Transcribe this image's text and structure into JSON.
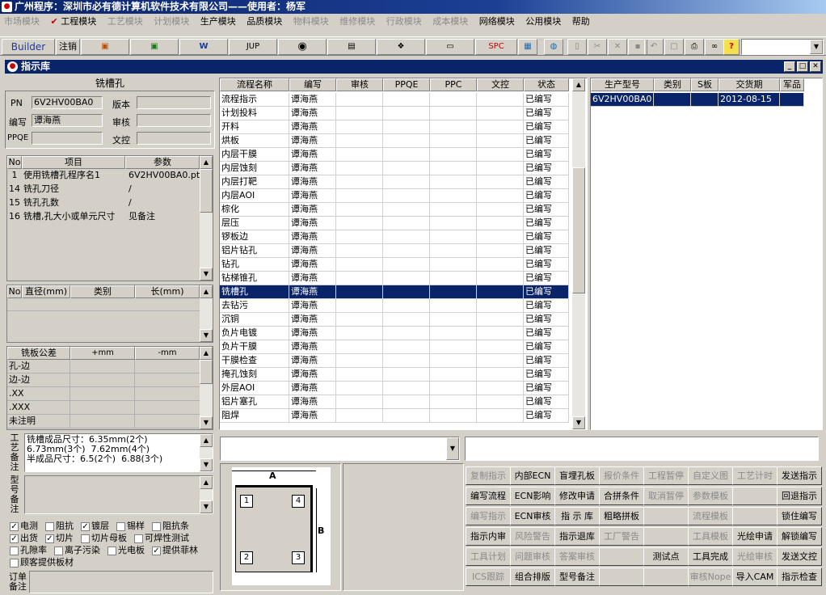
{
  "app_title": "广州程序：深圳市必有德计算机软件技术有限公司——使用者：杨军",
  "menu": [
    "市场模块",
    "工程模块",
    "工艺模块",
    "计划模块",
    "生产模块",
    "品质模块",
    "物料模块",
    "维修模块",
    "行政模块",
    "成本模块",
    "网络模块",
    "公用模块",
    "帮助"
  ],
  "toolbar": {
    "builder": "Builder",
    "logout": "注销",
    "jup": "JUP",
    "spc": "SPC"
  },
  "window_title": "指示库",
  "left": {
    "header": "铣槽孔",
    "pn_label": "PN",
    "pn_value": "6V2HV00BA0",
    "version_label": "版本",
    "author_label": "编写",
    "author_value": "谭海燕",
    "review_label": "审核",
    "ppqe_label": "PPQE",
    "doc_label": "文控",
    "params_cols": [
      "No",
      "项目",
      "参数"
    ],
    "params": [
      {
        "no": "1",
        "item": "使用铣槽孔程序名1",
        "val": "6V2HV00BA0.pth"
      },
      {
        "no": "14",
        "item": "铣孔刀径",
        "val": "/"
      },
      {
        "no": "15",
        "item": "铣孔孔数",
        "val": "/"
      },
      {
        "no": "16",
        "item": "铣槽,孔大小或单元尺寸",
        "val": "见备注"
      }
    ],
    "tool_cols": [
      "No",
      "直径(mm)",
      "类别",
      "长(mm)"
    ],
    "tol_cols": [
      "铣板公差",
      "+mm",
      "-mm"
    ],
    "tol_rows": [
      "孔-边",
      "边-边",
      ".XX",
      ".XXX",
      "未注明"
    ],
    "process_note_label": "工艺备注",
    "process_note": "铣槽成品尺寸：6.35mm(2个)  6.73mm(3个)  7.62mm(4个)\n半成品尺寸：6.5(2个)  6.88(3个)",
    "model_note_label": "型号备注",
    "checks": [
      [
        {
          "t": "电测",
          "c": true
        },
        {
          "t": "阻抗",
          "c": false
        },
        {
          "t": "镀层",
          "c": true
        },
        {
          "t": "锡样",
          "c": false
        },
        {
          "t": "阻抗条",
          "c": false
        }
      ],
      [
        {
          "t": "出货",
          "c": true
        },
        {
          "t": "切片",
          "c": true
        },
        {
          "t": "切片母板",
          "c": false
        },
        {
          "t": "可焊性测试",
          "c": false
        }
      ],
      [
        {
          "t": "孔隙率",
          "c": false
        },
        {
          "t": "离子污染",
          "c": false
        },
        {
          "t": "光电板",
          "c": false
        },
        {
          "t": "提供菲林",
          "c": true
        }
      ],
      [
        {
          "t": "顾客提供板材",
          "c": false
        }
      ]
    ],
    "order_note_label": "订单备注"
  },
  "process_cols": [
    "流程名称",
    "编写",
    "审核",
    "PPQE",
    "PPC",
    "文控",
    "状态"
  ],
  "process_rows": [
    {
      "name": "流程指示",
      "author": "谭海燕",
      "status": "已编写"
    },
    {
      "name": "计划投料",
      "author": "谭海燕",
      "status": "已编写"
    },
    {
      "name": "开料",
      "author": "谭海燕",
      "status": "已编写"
    },
    {
      "name": "烘板",
      "author": "谭海燕",
      "status": "已编写"
    },
    {
      "name": "内层干膜",
      "author": "谭海燕",
      "status": "已编写"
    },
    {
      "name": "内层蚀刻",
      "author": "谭海燕",
      "status": "已编写"
    },
    {
      "name": "内层打靶",
      "author": "谭海燕",
      "status": "已编写"
    },
    {
      "name": "内层AOI",
      "author": "谭海燕",
      "status": "已编写"
    },
    {
      "name": "棕化",
      "author": "谭海燕",
      "status": "已编写"
    },
    {
      "name": "层压",
      "author": "谭海燕",
      "status": "已编写"
    },
    {
      "name": "锣板边",
      "author": "谭海燕",
      "status": "已编写"
    },
    {
      "name": "铝片钻孔",
      "author": "谭海燕",
      "status": "已编写"
    },
    {
      "name": "钻孔",
      "author": "谭海燕",
      "status": "已编写"
    },
    {
      "name": "钻梯锥孔",
      "author": "谭海燕",
      "status": "已编写"
    },
    {
      "name": "铣槽孔",
      "author": "谭海燕",
      "status": "已编写"
    },
    {
      "name": "去钻污",
      "author": "谭海燕",
      "status": "已编写"
    },
    {
      "name": "沉铜",
      "author": "谭海燕",
      "status": "已编写"
    },
    {
      "name": "负片电镀",
      "author": "谭海燕",
      "status": "已编写"
    },
    {
      "name": "负片干膜",
      "author": "谭海燕",
      "status": "已编写"
    },
    {
      "name": "干膜检查",
      "author": "谭海燕",
      "status": "已编写"
    },
    {
      "name": "掩孔蚀刻",
      "author": "谭海燕",
      "status": "已编写"
    },
    {
      "name": "外层AOI",
      "author": "谭海燕",
      "status": "已编写"
    },
    {
      "name": "铝片塞孔",
      "author": "谭海燕",
      "status": "已编写"
    },
    {
      "name": "阻焊",
      "author": "谭海燕",
      "status": "已编写"
    }
  ],
  "selected_row": 14,
  "order_cols": [
    "生产型号",
    "类别",
    "S板",
    "交货期",
    "军品"
  ],
  "order_rows": [
    {
      "model": "6V2HV00BA0",
      "type": "",
      "s": "",
      "date": "2012-08-15",
      "mil": ""
    }
  ],
  "diagram": {
    "a": "A",
    "b": "B",
    "n1": "1",
    "n2": "2",
    "n3": "3",
    "n4": "4"
  },
  "buttons": [
    [
      {
        "t": "复制指示",
        "d": true
      },
      {
        "t": "内部ECN",
        "d": false
      },
      {
        "t": "盲埋孔板",
        "d": false
      },
      {
        "t": "报价条件",
        "d": true
      },
      {
        "t": "工程暂停",
        "d": true
      },
      {
        "t": "自定义图",
        "d": true
      },
      {
        "t": "工艺计时",
        "d": true
      },
      {
        "t": "发送指示",
        "d": false
      }
    ],
    [
      {
        "t": "编写流程",
        "d": false
      },
      {
        "t": "ECN影响",
        "d": false
      },
      {
        "t": "修改申请",
        "d": false
      },
      {
        "t": "合拼条件",
        "d": false
      },
      {
        "t": "取消暂停",
        "d": true
      },
      {
        "t": "参数模板",
        "d": true
      },
      {
        "t": "",
        "d": true
      },
      {
        "t": "回退指示",
        "d": false
      }
    ],
    [
      {
        "t": "编写指示",
        "d": true
      },
      {
        "t": "ECN审核",
        "d": false
      },
      {
        "t": "指 示 库",
        "d": false
      },
      {
        "t": "粗略拼板",
        "d": false
      },
      {
        "t": "",
        "d": true
      },
      {
        "t": "流程模板",
        "d": true
      },
      {
        "t": "",
        "d": true
      },
      {
        "t": "锁住编写",
        "d": false
      }
    ],
    [
      {
        "t": "指示内审",
        "d": false
      },
      {
        "t": "风险警告",
        "d": true
      },
      {
        "t": "指示退库",
        "d": false
      },
      {
        "t": "工厂警告",
        "d": true
      },
      {
        "t": "",
        "d": true
      },
      {
        "t": "工具模板",
        "d": true
      },
      {
        "t": "光绘申请",
        "d": false
      },
      {
        "t": "解锁编写",
        "d": false
      }
    ],
    [
      {
        "t": "工具计划",
        "d": true
      },
      {
        "t": "问题审核",
        "d": true
      },
      {
        "t": "答案审核",
        "d": true
      },
      {
        "t": "",
        "d": true
      },
      {
        "t": "测试点",
        "d": false
      },
      {
        "t": "工具完成",
        "d": false
      },
      {
        "t": "光绘审核",
        "d": true
      },
      {
        "t": "发送文控",
        "d": false
      }
    ],
    [
      {
        "t": "ICS跟踪",
        "d": true
      },
      {
        "t": "组合排版",
        "d": false
      },
      {
        "t": "型号备注",
        "d": false
      },
      {
        "t": "",
        "d": true
      },
      {
        "t": "",
        "d": true
      },
      {
        "t": "审核Nope",
        "d": true
      },
      {
        "t": "导入CAM",
        "d": false
      },
      {
        "t": "指示检查",
        "d": false
      }
    ]
  ]
}
